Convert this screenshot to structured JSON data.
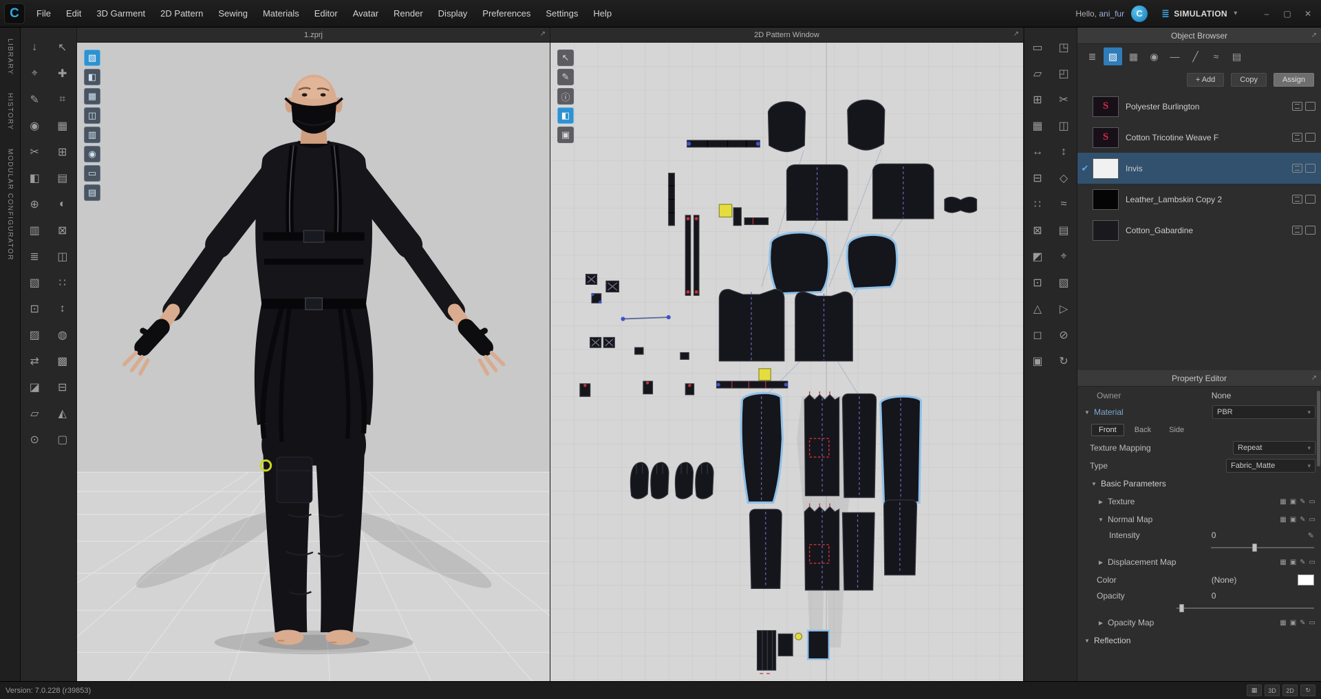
{
  "colors": {
    "accent": "#2e9bd6",
    "selection": "#31516e",
    "pattern_selected_outline": "#8fc1e8",
    "mark_yellow": "#e4dd3d",
    "mark_red": "#c23333"
  },
  "icons": {
    "minimize": "–",
    "maximize": "▢",
    "close": "✕",
    "caret_down": "▾",
    "popout": "↗",
    "sim_mode": "≣",
    "check": "✔",
    "collapse_open": "▼",
    "collapse_closed": "▶",
    "refresh": "↻",
    "logo": "C",
    "connect": "C",
    "pencil": "✎",
    "brand": "S",
    "map_slot": "▦",
    "map_link": "▣",
    "map_edit": "✎",
    "map_clear": "▭",
    "grid_small": "▦"
  },
  "titlebar": {
    "menus": [
      "File",
      "Edit",
      "3D Garment",
      "2D Pattern",
      "Sewing",
      "Materials",
      "Editor",
      "Avatar",
      "Render",
      "Display",
      "Preferences",
      "Settings",
      "Help"
    ],
    "greeting_prefix": "Hello, ",
    "username": "ani_fur",
    "mode_label": "SIMULATION"
  },
  "side_tabs": [
    {
      "label": "LIBRARY"
    },
    {
      "label": "HISTORY"
    },
    {
      "label": "MODULAR CONFIGURATOR"
    }
  ],
  "left_toolbar": {
    "tools": [
      {
        "name": "simulate",
        "glyph": "↓"
      },
      {
        "name": "select-move",
        "glyph": "↖"
      },
      {
        "name": "select-box",
        "glyph": "⌖"
      },
      {
        "name": "transform-pattern",
        "glyph": "✚"
      },
      {
        "name": "edit-pattern",
        "glyph": "✎"
      },
      {
        "name": "edit-curvature",
        "glyph": "⌗"
      },
      {
        "name": "add-point",
        "glyph": "◉"
      },
      {
        "name": "add-pattern",
        "glyph": "▦"
      },
      {
        "name": "trace",
        "glyph": "✂"
      },
      {
        "name": "sew-segment",
        "glyph": "⊞"
      },
      {
        "name": "sew-free",
        "glyph": "◧"
      },
      {
        "name": "edit-sewing",
        "glyph": "▤"
      },
      {
        "name": "pin",
        "glyph": "⊕"
      },
      {
        "name": "tack",
        "glyph": "◐"
      },
      {
        "name": "fold-arrangement",
        "glyph": "▥"
      },
      {
        "name": "wind",
        "glyph": "⊠"
      },
      {
        "name": "zipper",
        "glyph": "≣"
      },
      {
        "name": "button",
        "glyph": "◫"
      },
      {
        "name": "buttonhole",
        "glyph": "▧"
      },
      {
        "name": "topstitch",
        "glyph": "∷"
      },
      {
        "name": "edit-topstitch",
        "glyph": "⊡"
      },
      {
        "name": "piping",
        "glyph": "↕"
      },
      {
        "name": "binding",
        "glyph": "▨"
      },
      {
        "name": "dart",
        "glyph": "◍"
      },
      {
        "name": "measure-tape",
        "glyph": "⇄"
      },
      {
        "name": "edit-measure",
        "glyph": "▩"
      },
      {
        "name": "flatten",
        "glyph": "◪"
      },
      {
        "name": "uv-edit",
        "glyph": "⊟"
      },
      {
        "name": "grade",
        "glyph": "▱"
      },
      {
        "name": "scale",
        "glyph": "◭"
      },
      {
        "name": "steam",
        "glyph": "⊙"
      },
      {
        "name": "solidify",
        "glyph": "▢"
      }
    ]
  },
  "right_toolbar": {
    "tools": [
      {
        "name": "edit-pattern-2d",
        "glyph": "▭"
      },
      {
        "name": "transform-2d",
        "glyph": "◳"
      },
      {
        "name": "create-polygon",
        "glyph": "▱"
      },
      {
        "name": "create-rect",
        "glyph": "◰"
      },
      {
        "name": "create-circle",
        "glyph": "⊞"
      },
      {
        "name": "edit-curve",
        "glyph": "✂"
      },
      {
        "name": "add-point-2d",
        "glyph": "▦"
      },
      {
        "name": "seam-allowance",
        "glyph": "◫"
      },
      {
        "name": "cut",
        "glyph": "↔"
      },
      {
        "name": "cut-sew",
        "glyph": "↕"
      },
      {
        "name": "notch",
        "glyph": "⊟"
      },
      {
        "name": "dart-2d",
        "glyph": "◇"
      },
      {
        "name": "pleats",
        "glyph": "∷"
      },
      {
        "name": "internal-line",
        "glyph": "≈"
      },
      {
        "name": "internal-rect",
        "glyph": "⊠"
      },
      {
        "name": "internal-circle",
        "glyph": "▤"
      },
      {
        "name": "base-line",
        "glyph": "◩"
      },
      {
        "name": "trace-2d",
        "glyph": "⌖"
      },
      {
        "name": "symmetric",
        "glyph": "⊡"
      },
      {
        "name": "unfold",
        "glyph": "▧"
      },
      {
        "name": "texture-edit",
        "glyph": "△"
      },
      {
        "name": "grain-line",
        "glyph": "▷"
      },
      {
        "name": "annotation",
        "glyph": "◻"
      },
      {
        "name": "pattern-annotation",
        "glyph": "⊘"
      },
      {
        "name": "grading-2d",
        "glyph": "▣"
      },
      {
        "name": "refresh-2d",
        "glyph": "↻"
      }
    ]
  },
  "viewport3d": {
    "title": "1.zprj",
    "overlay_tools": [
      {
        "name": "show-avatar",
        "glyph": "▧"
      },
      {
        "name": "surface-texture",
        "glyph": "◧"
      },
      {
        "name": "mesh-type",
        "glyph": "▦"
      },
      {
        "name": "show-internal-lines",
        "glyph": "◫"
      },
      {
        "name": "show-sewing",
        "glyph": "▥"
      },
      {
        "name": "show-pins",
        "glyph": "◉"
      },
      {
        "name": "avatar-tape",
        "glyph": "▭"
      },
      {
        "name": "show-arrangement",
        "glyph": "▤"
      }
    ]
  },
  "viewport2d": {
    "title": "2D Pattern Window",
    "overlay_tools": [
      {
        "name": "transform-pattern",
        "glyph": "↖"
      },
      {
        "name": "edit-pattern",
        "glyph": "✎"
      },
      {
        "name": "pattern-info",
        "glyph": "ⓘ"
      },
      {
        "name": "show-texture",
        "glyph": "◧"
      },
      {
        "name": "lock-pattern",
        "glyph": "▣"
      }
    ]
  },
  "object_browser": {
    "title": "Object Browser",
    "add_label": "+ Add",
    "copy_label": "Copy",
    "assign_label": "Assign",
    "mode_icons": [
      {
        "name": "scene-list",
        "glyph": "≣"
      },
      {
        "name": "fabric-view",
        "glyph": "▨"
      },
      {
        "name": "graphic-view",
        "glyph": "▦"
      },
      {
        "name": "button-view",
        "glyph": "◉"
      },
      {
        "name": "topstitch-view",
        "glyph": "—"
      },
      {
        "name": "trim-view",
        "glyph": "╱"
      },
      {
        "name": "puckering-view",
        "glyph": "≈"
      },
      {
        "name": "layer-view",
        "glyph": "▤"
      }
    ],
    "materials": [
      {
        "name": "Polyester Burlington",
        "thumb": "brand-dark",
        "selected": false
      },
      {
        "name": "Cotton Tricotine Weave F",
        "thumb": "brand-dark",
        "selected": false
      },
      {
        "name": "Invis",
        "thumb": "white",
        "selected": true
      },
      {
        "name": "Leather_Lambskin Copy 2",
        "thumb": "black",
        "selected": false
      },
      {
        "name": "Cotton_Gabardine",
        "thumb": "dark",
        "selected": false
      }
    ]
  },
  "property_editor": {
    "title": "Property Editor",
    "owner_label": "Owner",
    "owner_value": "None",
    "material_label": "Material",
    "material_value": "PBR",
    "tabs": [
      "Front",
      "Back",
      "Side"
    ],
    "texture_mapping_label": "Texture Mapping",
    "texture_mapping_value": "Repeat",
    "type_label": "Type",
    "type_value": "Fabric_Matte",
    "basic_parameters_label": "Basic Parameters",
    "texture_label": "Texture",
    "normal_map_label": "Normal Map",
    "intensity_label": "Intensity",
    "intensity_value": "0",
    "displacement_map_label": "Displacement Map",
    "color_label": "Color",
    "color_value": "(None)",
    "opacity_label": "Opacity",
    "opacity_value": "0",
    "opacity_map_label": "Opacity Map",
    "reflection_label": "Reflection"
  },
  "statusbar": {
    "version_text": "Version: 7.0.228 (r39853)",
    "btn_3d": "3D",
    "btn_2d": "2D"
  }
}
